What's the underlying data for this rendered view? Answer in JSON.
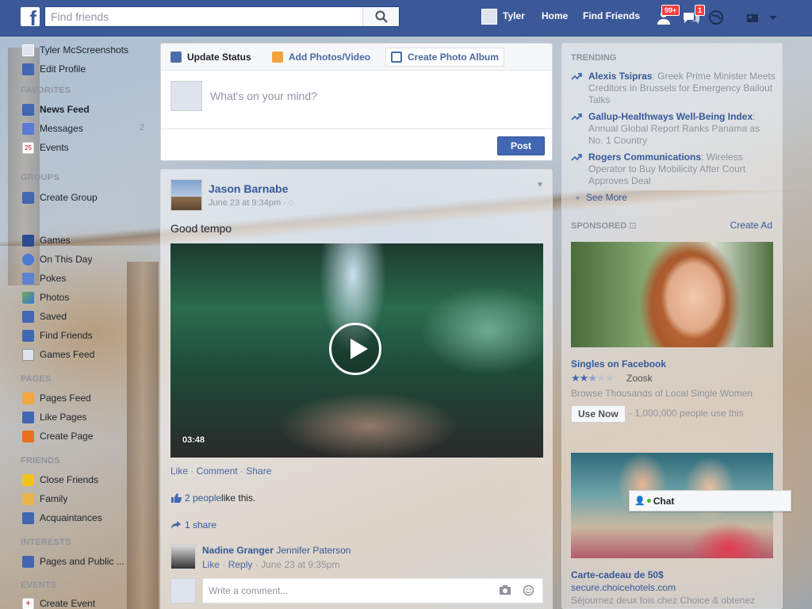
{
  "topbar": {
    "logo": "f",
    "search_placeholder": "Find friends",
    "user_name": "Tyler",
    "home": "Home",
    "find_friends": "Find Friends",
    "friend_requests_badge": "99+",
    "messages_badge": "1"
  },
  "leftnav": {
    "profile_name": "Tyler McScreenshots",
    "edit_profile": "Edit Profile",
    "favorites_head": "FAVORITES",
    "news_feed": "News Feed",
    "messages": "Messages",
    "messages_count": "2",
    "events": "Events",
    "events_icon_day": "25",
    "groups_head": "GROUPS",
    "create_group": "Create Group",
    "apps": [
      "Games",
      "On This Day",
      "Pokes",
      "Photos",
      "Saved",
      "Find Friends",
      "Games Feed"
    ],
    "pages_head": "PAGES",
    "pages_feed": "Pages Feed",
    "like_pages": "Like Pages",
    "create_page": "Create Page",
    "friends_head": "FRIENDS",
    "close_friends": "Close Friends",
    "family": "Family",
    "acquaintances": "Acquaintances",
    "interests_head": "INTERESTS",
    "pages_public": "Pages and Public ...",
    "events_head": "EVENTS",
    "create_event": "Create Event"
  },
  "composer": {
    "tab_status": "Update Status",
    "tab_photos": "Add Photos/Video",
    "tab_album": "Create Photo Album",
    "placeholder": "What's on your mind?",
    "post_button": "Post"
  },
  "post": {
    "author": "Jason Barnabe",
    "time": "June 23 at 9:34pm · ",
    "text": "Good tempo",
    "video_duration": "03:48",
    "like": "Like",
    "comment": "Comment",
    "share": "Share",
    "likes_people": "2 people",
    "likes_suffix": " like this.",
    "shares": "1 share",
    "comment_author": "Nadine Granger",
    "comment_tagged": "Jennifer Paterson",
    "comment_like": "Like",
    "comment_reply": "Reply",
    "comment_time": "June 23 at 9:35pm",
    "write_comment_placeholder": "Write a comment..."
  },
  "trending": {
    "head": "TRENDING",
    "items": [
      {
        "title": "Alexis Tsipras",
        "desc": ": Greek Prime Minister Meets Creditors in Brussels for Emergency Bailout Talks"
      },
      {
        "title": "Gallup-Healthways Well-Being Index",
        "desc": ": Annual Global Report Ranks Panama as No. 1 Country"
      },
      {
        "title": "Rogers Communications",
        "desc": ": Wireless Operator to Buy Mobilicity After Court Approves Deal"
      }
    ],
    "see_more": "See More"
  },
  "sponsored": {
    "head": "SPONSORED",
    "create_ad": "Create Ad",
    "ad1": {
      "title": "Singles on Facebook",
      "rating": 2.5,
      "rating_max": 5,
      "brand": "Zoosk",
      "desc": "Browse Thousands of Local Single Women",
      "cta": "Use Now",
      "social": "· 1,000,000 people use this"
    },
    "ad2": {
      "title": "Carte-cadeau de 50$",
      "url": "secure.choicehotels.com",
      "desc": "Séjournez deux fois chez Choice & obtenez"
    }
  },
  "chat": {
    "label": "Chat"
  },
  "colors": {
    "brand": "#3b5998",
    "link": "#365899",
    "badge": "#fa3e3e",
    "button": "#4267b2"
  }
}
